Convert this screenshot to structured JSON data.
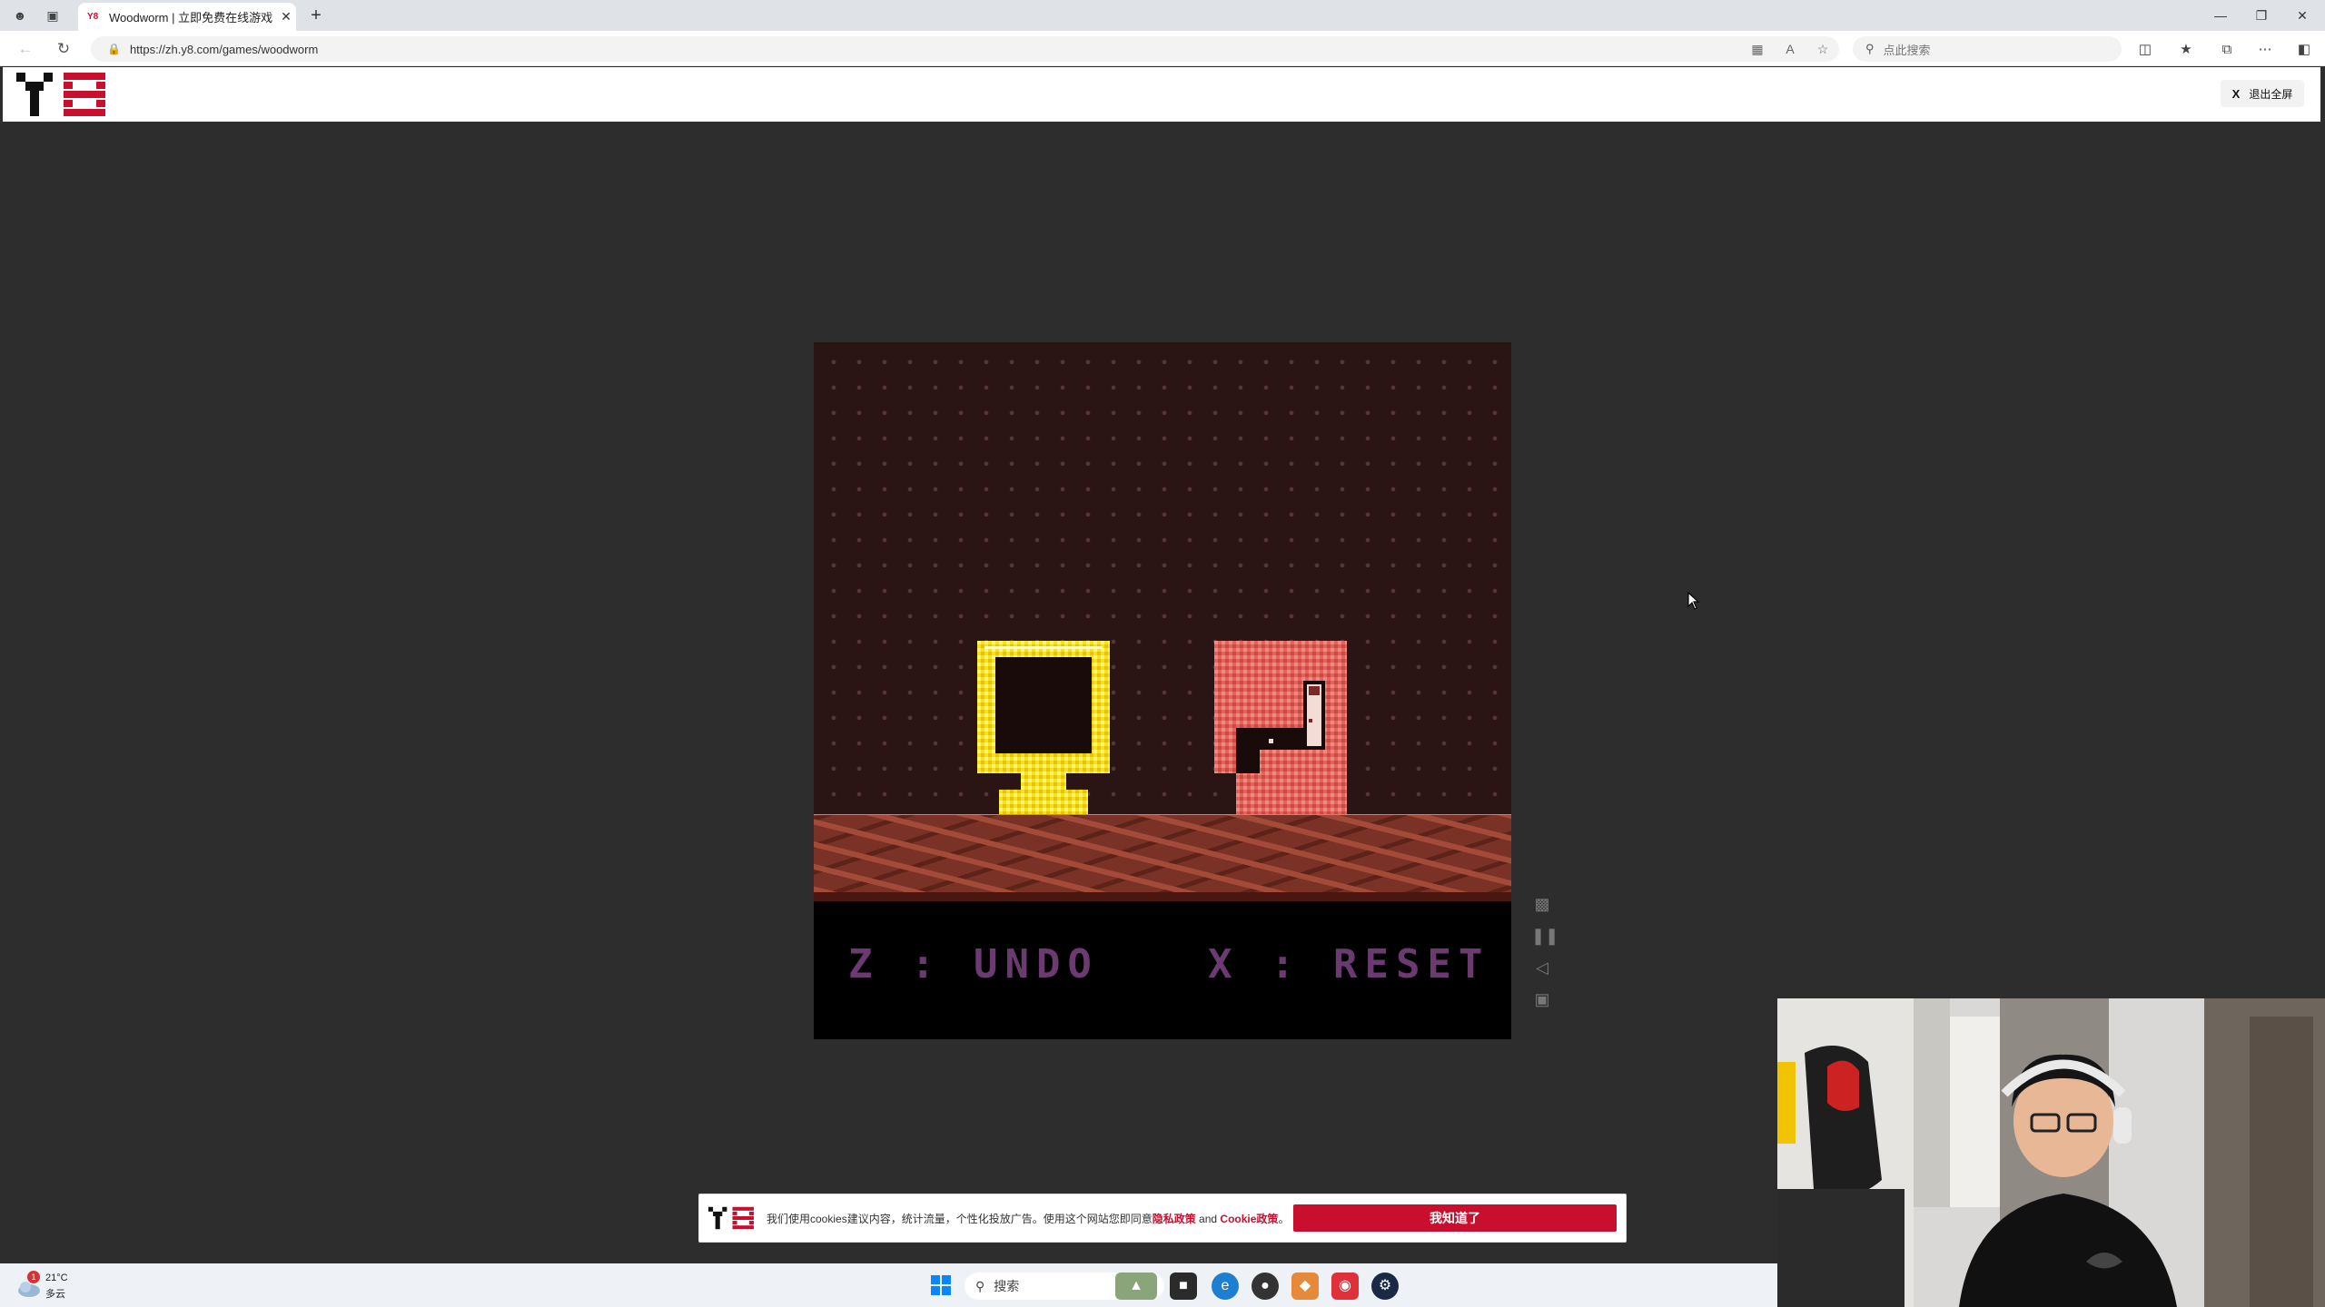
{
  "browser": {
    "tab_title": "Woodworm | 立即免费在线游戏 -",
    "tab_favicon": "Y8",
    "url": "https://zh.y8.com/games/woodworm",
    "search_placeholder": "点此搜索",
    "icons": [
      "profile-icon",
      "tab-actions-icon",
      "back-icon",
      "refresh-icon",
      "lock-icon",
      "app-available-icon",
      "read-aloud-icon",
      "favorite-star-icon",
      "search-icon",
      "split-screen-icon",
      "favorites-icon",
      "collections-icon",
      "more-icon",
      "sidebar-icon",
      "minimize-icon",
      "restore-icon",
      "close-icon"
    ]
  },
  "site": {
    "logo_text": "Y8",
    "exit_fullscreen_key": "X",
    "exit_fullscreen_label": "退出全屏"
  },
  "game": {
    "name": "Woodworm",
    "hud_undo": "Z : UNDO",
    "hud_reset": "X : RESET",
    "colors": {
      "background": "#2a1414",
      "trophy": "#f5e21a",
      "worm_block": "#e2635a",
      "ground": "#7a3226",
      "hud_text": "#6b3a70"
    }
  },
  "side_controls": [
    "gamepad-icon",
    "pause-icon",
    "volume-icon",
    "fullscreen-icon"
  ],
  "cookie": {
    "text_before": "我们使用cookies建议内容，统计流量，个性化投放广告。使用这个网站您即同意",
    "privacy_link": "隐私政策",
    "text_and": " and ",
    "cookie_link": "Cookie政策",
    "text_end": "。",
    "accept_button": "我知道了"
  },
  "taskbar": {
    "weather_temp": "21°C",
    "weather_desc": "多云",
    "weather_badge": "1",
    "search_label": "搜索",
    "apps": [
      "widgets-icon",
      "file-explorer-icon",
      "edge-icon",
      "chrome-icon",
      "app-icon",
      "netease-music-icon",
      "steam-icon"
    ]
  }
}
